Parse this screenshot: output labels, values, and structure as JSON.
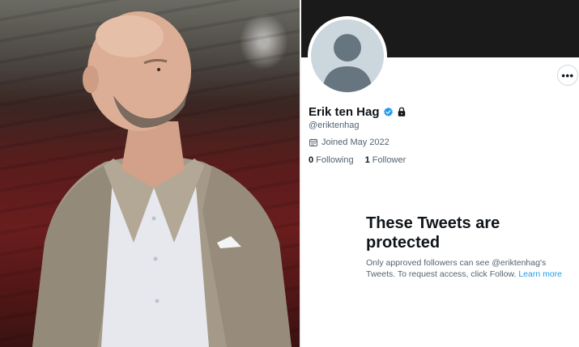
{
  "photo": {
    "subject": "Man in beige blazer and white shirt standing in a red-seated football stadium"
  },
  "profile": {
    "name": "Erik ten Hag",
    "handle": "@eriktenhag",
    "joined": "Joined May 2022",
    "following": {
      "count": "0",
      "label": "Following"
    },
    "followers": {
      "count": "1",
      "label": "Follower"
    },
    "more_label": "•••",
    "protected": {
      "title_line1": "These Tweets are",
      "title_line2": "protected",
      "body": "Only approved followers can see @eriktenhag's Tweets. To request access, click Follow. ",
      "learn_more": "Learn more"
    },
    "colors": {
      "accent": "#1d9bf0",
      "banner": "#1a1a1a",
      "secondary_text": "#536471",
      "primary_text": "#0f1419"
    },
    "icons": [
      "verified-badge-icon",
      "lock-icon",
      "calendar-icon",
      "more-icon",
      "default-avatar-icon"
    ]
  }
}
